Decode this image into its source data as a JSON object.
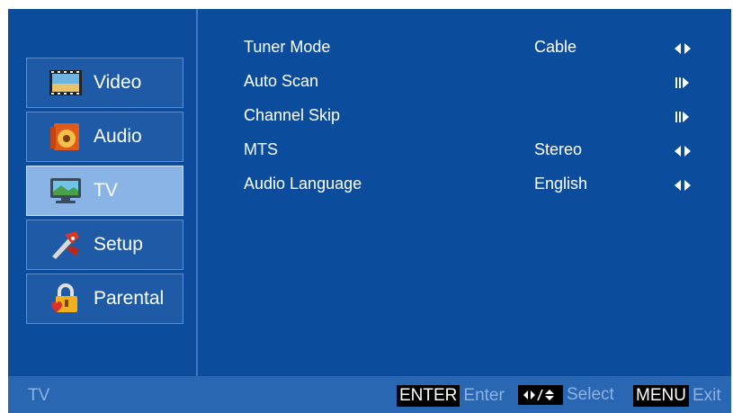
{
  "sidebar": {
    "items": [
      {
        "label": "Video",
        "icon": "video-icon",
        "active": false
      },
      {
        "label": "Audio",
        "icon": "audio-icon",
        "active": false
      },
      {
        "label": "TV",
        "icon": "tv-icon",
        "active": true
      },
      {
        "label": "Setup",
        "icon": "setup-icon",
        "active": false
      },
      {
        "label": "Parental",
        "icon": "parental-lock-icon",
        "active": false
      }
    ]
  },
  "menu": {
    "rows": [
      {
        "label": "Tuner Mode",
        "value": "Cable",
        "arrow": "left-right-arrow-icon"
      },
      {
        "label": "Auto Scan",
        "value": "",
        "arrow": "enter-right-arrow-icon"
      },
      {
        "label": "Channel Skip",
        "value": "",
        "arrow": "enter-right-arrow-icon"
      },
      {
        "label": "MTS",
        "value": "Stereo",
        "arrow": "left-right-arrow-icon"
      },
      {
        "label": "Audio Language",
        "value": "English",
        "arrow": "left-right-arrow-icon"
      }
    ]
  },
  "statusbar": {
    "title": "TV",
    "enter_key": "ENTER",
    "enter_text": "Enter",
    "select_text": "Select",
    "menu_key": "MENU",
    "exit_text": "Exit"
  },
  "colors": {
    "background": "#0b4d9c",
    "sidebar_item": "#1e5aa6",
    "sidebar_active": "#8ab3e6",
    "statusbar": "#2a67b3",
    "hint_text": "#8db3e2"
  }
}
